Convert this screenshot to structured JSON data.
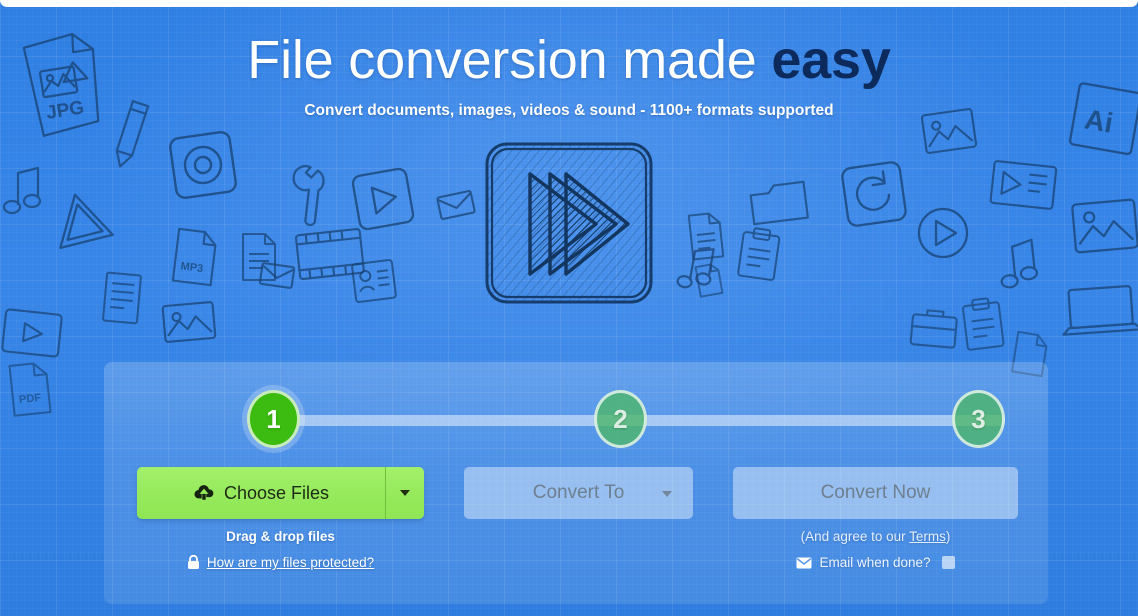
{
  "hero": {
    "headline_main": "File conversion made ",
    "headline_accent": "easy",
    "subhead": "Convert documents, images, videos & sound - 1100+ formats supported"
  },
  "logo": {
    "name": "zamzar-play-logo"
  },
  "steps": [
    {
      "number": "1",
      "state": "active"
    },
    {
      "number": "2",
      "state": "inactive"
    },
    {
      "number": "3",
      "state": "inactive"
    }
  ],
  "controls": {
    "choose_files_label": "Choose Files",
    "choose_files_icon": "cloud-upload-icon",
    "choose_dropdown_icon": "chevron-down-icon",
    "dragdrop_label": "Drag & drop files",
    "protected_icon": "lock-icon",
    "protected_label": "How are my files protected?",
    "convert_to_label": "Convert To",
    "convert_to_caret_icon": "chevron-down-icon",
    "convert_now_label": "Convert Now",
    "terms_prefix": "(And agree to our ",
    "terms_link_label": "Terms",
    "terms_suffix": ")",
    "email_icon": "envelope-icon",
    "email_label": "Email when done?",
    "email_checked": false
  },
  "colors": {
    "background_blue": "#3886e8",
    "accent_navy": "#0d2a5c",
    "button_green": "#96ea5c",
    "step_active_green": "#3cbb10",
    "step_inactive_green": "#4eb76a",
    "disabled_text": "#6e7f8f"
  }
}
